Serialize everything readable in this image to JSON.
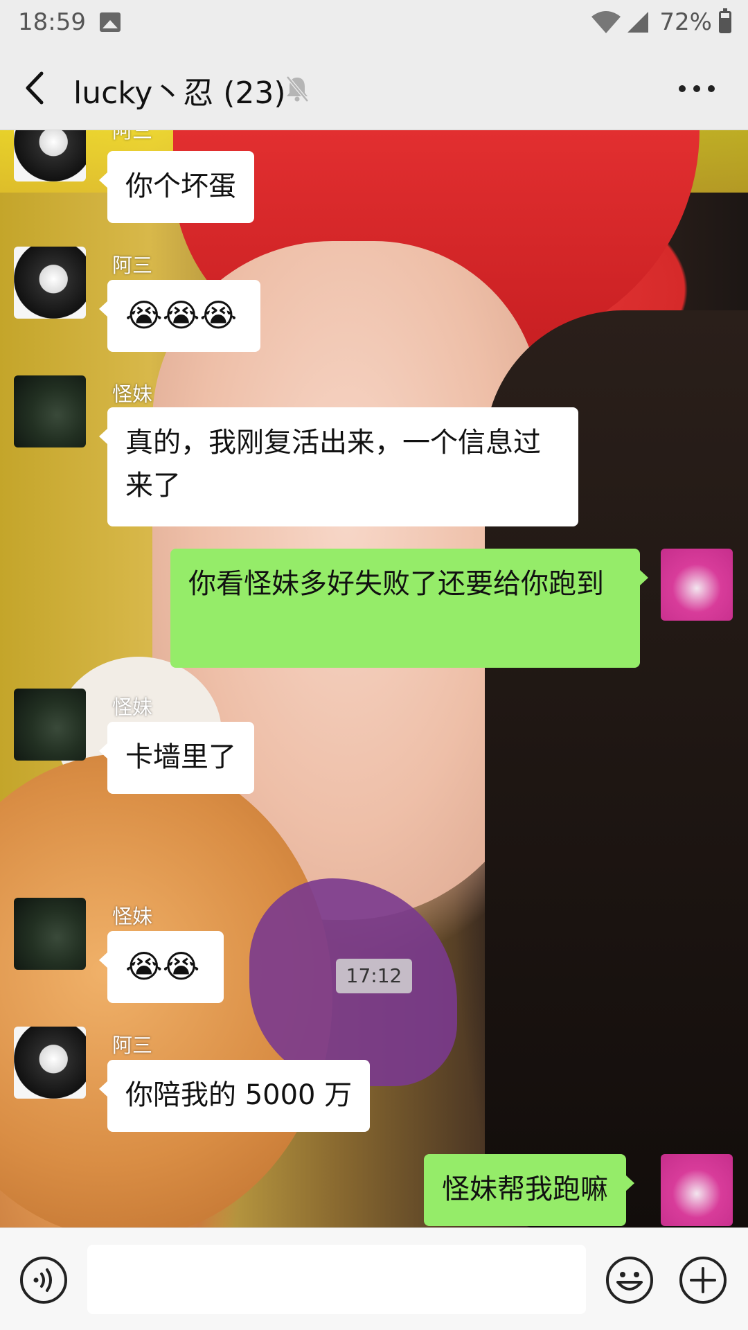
{
  "status_bar": {
    "time": "18:59",
    "battery": "72%",
    "battery_level": 0.72
  },
  "nav": {
    "title": "lucky丶忍 (23)"
  },
  "messages": [
    {
      "sender": "阿三",
      "text": "你个坏蛋"
    },
    {
      "sender": "阿三",
      "text": "😭😭😭"
    },
    {
      "sender": "怪妹",
      "text": "真的，我刚复活出来，一个信息过来了"
    },
    {
      "sender": "",
      "text": "你看怪妹多好失败了还要给你跑到"
    },
    {
      "sender": "怪妹",
      "text": "卡墙里了"
    },
    {
      "sender": "怪妹",
      "text": "😭😭"
    },
    {
      "sender": "阿三",
      "text": "你陪我的 5000 万"
    },
    {
      "sender": "",
      "text": "怪妹帮我跑嘛"
    }
  ],
  "time_divider": "17:12",
  "input": {
    "value": "",
    "placeholder": ""
  },
  "colors": {
    "own_bubble": "#95ec69",
    "other_bubble": "#ffffff",
    "header_bg": "#ededed"
  },
  "icons": {
    "back": "chevron-left-icon",
    "mute": "bell-off-icon",
    "more": "more-dots-icon",
    "voice": "voice-icon",
    "emoji": "emoji-icon",
    "plus": "plus-icon"
  }
}
